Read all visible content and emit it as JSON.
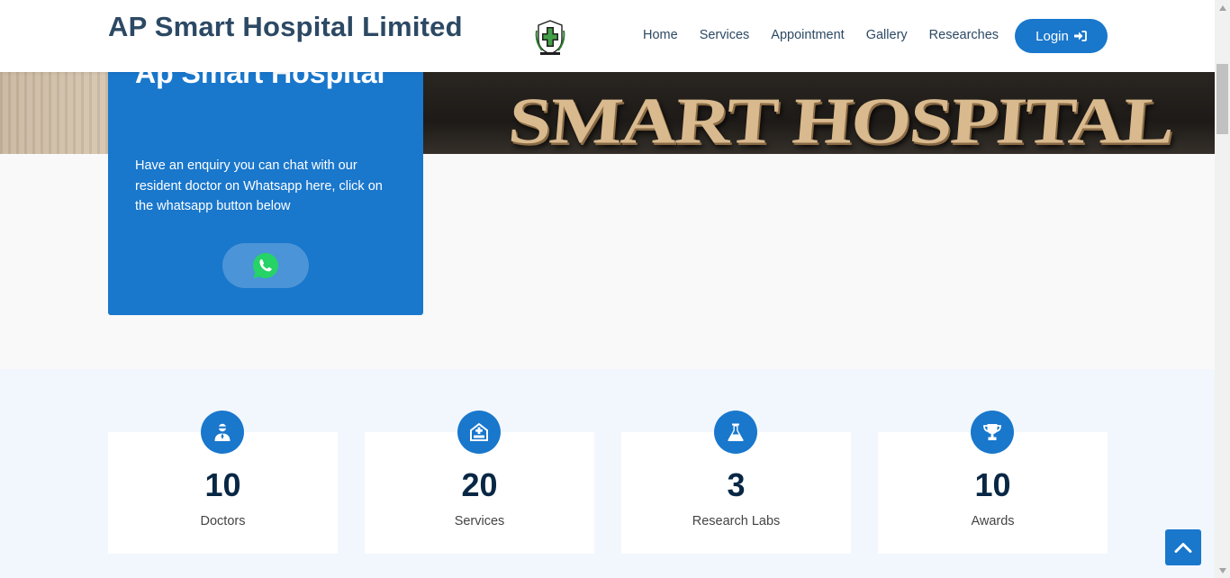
{
  "header": {
    "brand": "AP Smart Hospital Limited",
    "logo_icon": "hospital-crest-logo",
    "nav": [
      "Home",
      "Services",
      "Appointment",
      "Gallery",
      "Researches"
    ],
    "login_label": "Login",
    "login_icon": "sign-in-icon"
  },
  "hero": {
    "sign_text": "SMART HOSPITAL"
  },
  "enquiry": {
    "title": "Ap Smart Hospital",
    "text": "Have an enquiry you can chat with our resident doctor on Whatsapp here, click on the whatsapp button below",
    "button_icon": "whatsapp-icon"
  },
  "counts": [
    {
      "value": "10",
      "label": "Doctors",
      "icon": "doctor-icon"
    },
    {
      "value": "20",
      "label": "Services",
      "icon": "hospital-bed-icon"
    },
    {
      "value": "3",
      "label": "Research Labs",
      "icon": "flask-icon"
    },
    {
      "value": "10",
      "label": "Awards",
      "icon": "trophy-icon"
    }
  ],
  "back_to_top_icon": "chevron-up-icon",
  "colors": {
    "accent": "#1977cc",
    "heading": "#2c4964",
    "count_number": "#082744",
    "counts_bg": "#f1f7fd",
    "whatsapp": "#25d366"
  }
}
